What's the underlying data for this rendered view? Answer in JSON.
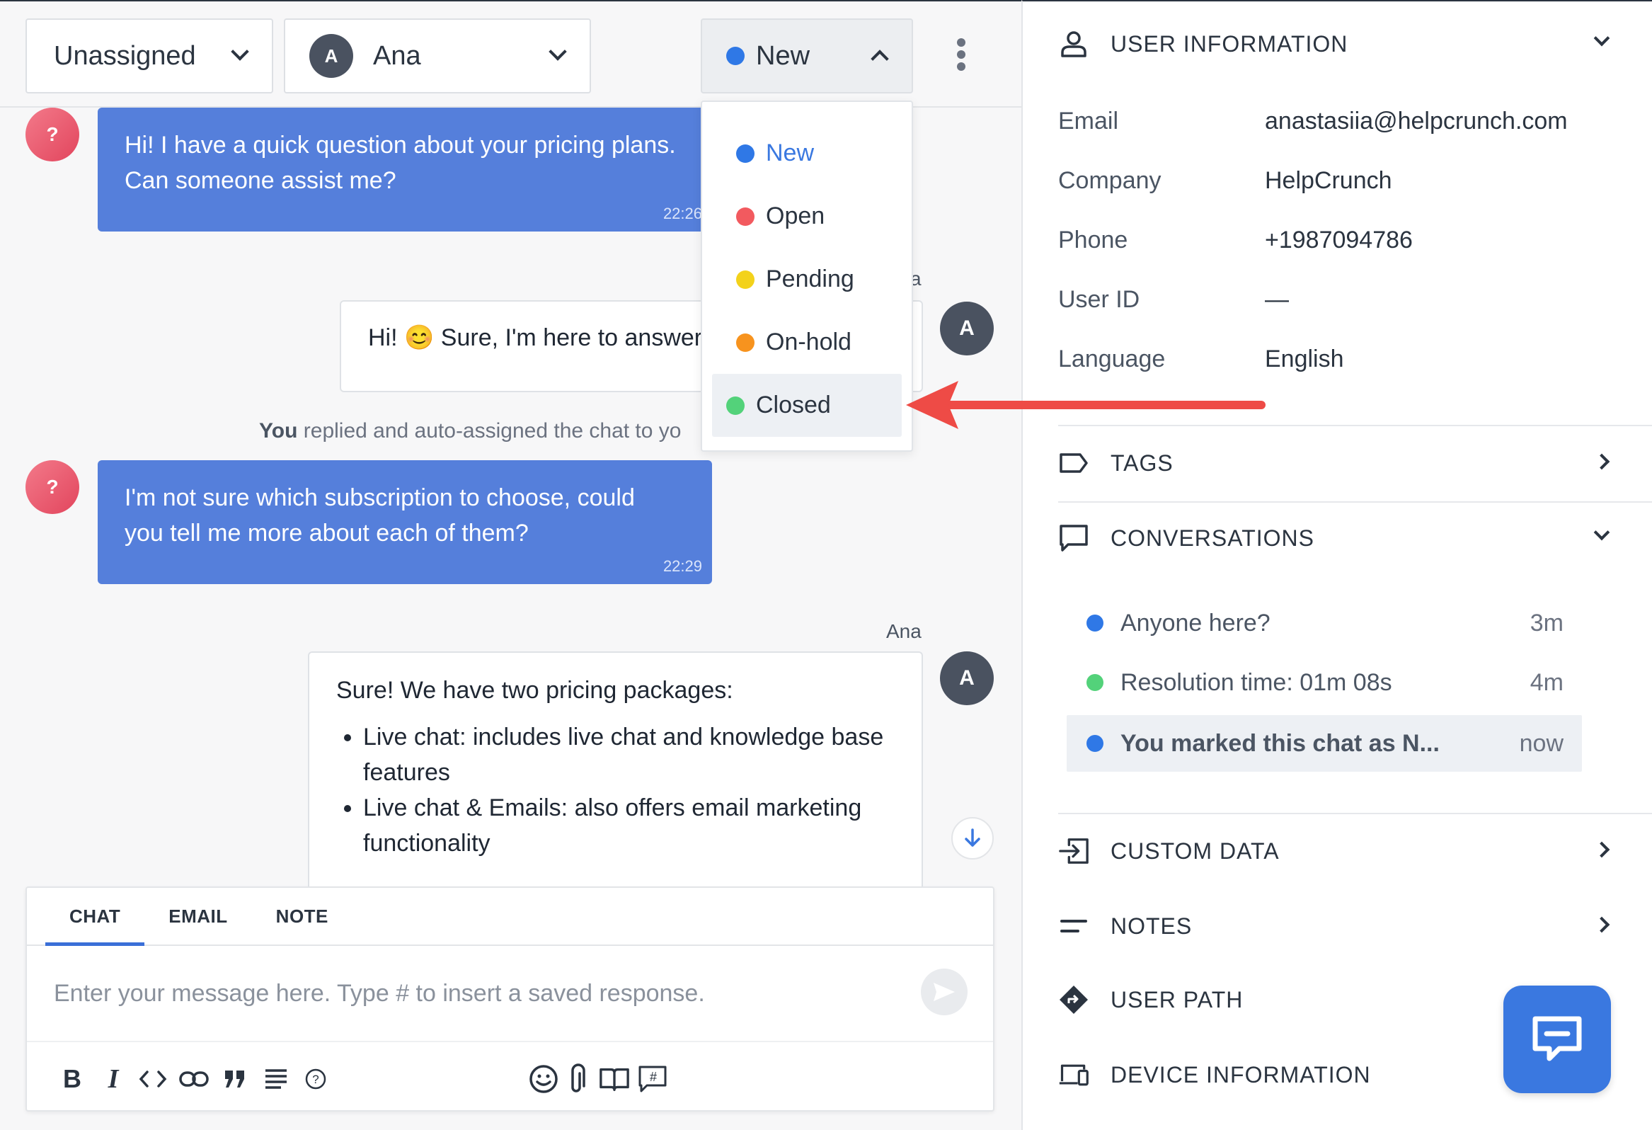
{
  "colors": {
    "new": "#2f78e6",
    "open": "#f25a5f",
    "pending": "#f3d21b",
    "onhold": "#f7931e",
    "closed": "#53d27a",
    "customer_bubble": "#557fdb",
    "accent": "#3a78e0",
    "arrow": "#ee4b46"
  },
  "topbar": {
    "assign_label": "Unassigned",
    "agent_initial": "A",
    "agent_label": "Ana",
    "status_label": "New"
  },
  "status_menu": {
    "items": [
      {
        "label": "New",
        "color": "#2f78e6"
      },
      {
        "label": "Open",
        "color": "#f25a5f"
      },
      {
        "label": "Pending",
        "color": "#f3d21b"
      },
      {
        "label": "On-hold",
        "color": "#f7931e"
      },
      {
        "label": "Closed",
        "color": "#53d27a"
      }
    ]
  },
  "messages": {
    "m1": {
      "avatar": "?",
      "line1": "Hi! I have a quick question about your pricing plans.",
      "line2": "Can someone assist me?",
      "time": "22:26"
    },
    "m2": {
      "agent_fragment": "a",
      "avatar": "A",
      "text": "Hi! 😊 Sure, I'm here to answer a"
    },
    "system": {
      "actor": "You",
      "text": " replied and auto-assigned the chat to yo"
    },
    "m3": {
      "avatar": "?",
      "line1": "I'm not sure which subscription to choose, could",
      "line2": "you tell me more about each of them?",
      "time": "22:29"
    },
    "m4": {
      "agent": "Ana",
      "avatar": "A",
      "intro": "Sure! We have two pricing packages:",
      "bullet1": "Live chat: includes live chat and knowledge base features",
      "bullet2": "Live chat & Emails: also offers email marketing functionality"
    }
  },
  "composer": {
    "tabs": [
      "CHAT",
      "EMAIL",
      "NOTE"
    ],
    "placeholder": "Enter your message here. Type # to insert a saved response."
  },
  "sidebar": {
    "user_info": {
      "title": "USER INFORMATION",
      "rows": [
        {
          "label": "Email",
          "value": "anastasiia@helpcrunch.com"
        },
        {
          "label": "Company",
          "value": "HelpCrunch"
        },
        {
          "label": "Phone",
          "value": "+1987094786"
        },
        {
          "label": "User ID",
          "value": "—"
        },
        {
          "label": "Language",
          "value": "English"
        }
      ]
    },
    "tags_title": "TAGS",
    "conversations": {
      "title": "CONVERSATIONS",
      "items": [
        {
          "text": "Anyone here?",
          "ago": "3m",
          "color": "#2f78e6"
        },
        {
          "text": "Resolution time: 01m 08s",
          "ago": "4m",
          "color": "#53d27a"
        },
        {
          "text": "You marked this chat as N...",
          "ago": "now",
          "color": "#2f78e6"
        }
      ]
    },
    "custom_data_title": "CUSTOM DATA",
    "notes_title": "NOTES",
    "user_path_title": "USER PATH",
    "device_info_title": "DEVICE INFORMATION"
  }
}
